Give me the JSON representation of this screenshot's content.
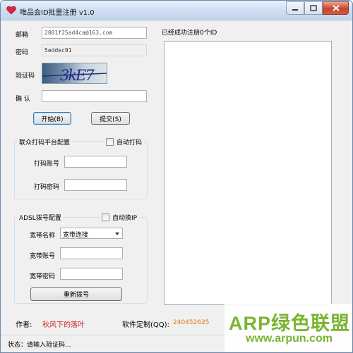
{
  "window": {
    "title": "唯品会ID批量注册 v1.0",
    "controls": [
      "minimize-icon",
      "maximize-icon",
      "close-icon"
    ]
  },
  "form": {
    "email_label": "邮箱",
    "email_value": "2801f25ad4ca@163.com",
    "password_label": "密码",
    "password_value": "5eddec91",
    "captcha_label": "验证码",
    "captcha_image_text": "3kE7",
    "confirm_label": "确 认",
    "confirm_value": "",
    "start_button": "开始(B)",
    "submit_button": "提交(S)"
  },
  "captcha_platform": {
    "title": "联众打码平台配置",
    "auto_checkbox": "自动打码",
    "auto_checked": false,
    "account_label": "打码账号",
    "account_value": "",
    "password_label": "打码密码",
    "password_value": ""
  },
  "adsl": {
    "title": "ADSL拨号配置",
    "auto_checkbox": "自动换IP",
    "auto_checked": false,
    "name_label": "宽带名称",
    "name_value": "宽带连接",
    "account_label": "宽带账号",
    "account_value": "",
    "password_label": "宽带密码",
    "password_value": "",
    "redial_button": "重新拨号"
  },
  "results": {
    "label": "已经成功注册0个ID",
    "items": []
  },
  "footer": {
    "author_label": "作者:",
    "author_name": "秋风下的落叶",
    "custom_label": "软件定制(QQ):",
    "qq_number": "240452625",
    "status_text": "状态：请输入验证码..."
  },
  "watermark": {
    "main": "ARP绿色联盟",
    "url": "www.arpun.com"
  },
  "colors": {
    "author_name": "#d21e1e",
    "qq_number": "#e07a10",
    "watermark": "#7ab531"
  }
}
